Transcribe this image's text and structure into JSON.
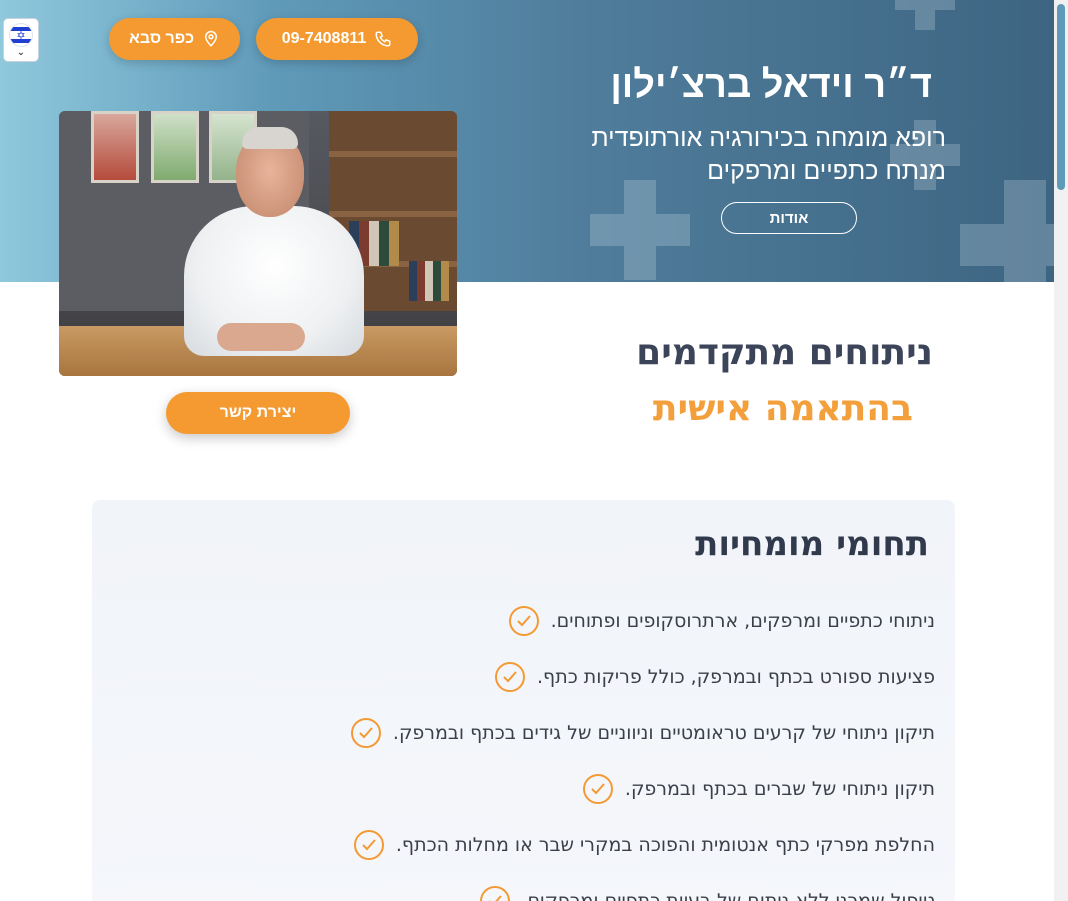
{
  "header": {
    "phone": "09-7408811",
    "location": "כפר סבא",
    "language_flag": "israel-flag"
  },
  "hero": {
    "doctor_name": "ד״ר וידאל ברצ׳ילון",
    "subtitle_line1": "רופא מומחה בכירורגיה אורתופדית",
    "subtitle_line2": "מנתח כתפיים ומרפקים",
    "about_label": "אודות"
  },
  "contact_label": "יצירת קשר",
  "tagline": {
    "line1": "ניתוחים מתקדמים",
    "line2": "בהתאמה אישית"
  },
  "expertise": {
    "title": "תחומי מומחיות",
    "items": [
      "ניתוחי כתפיים ומרפקים, ארתרוסקופים ופתוחים.",
      "פציעות ספורט בכתף ובמרפק, כולל פריקות כתף.",
      "תיקון ניתוחי של קרעים טראומטיים וניווניים של גידים בכתף ובמרפק.",
      "תיקון ניתוחי של שברים בכתף ובמרפק.",
      "החלפת מפרקי כתף אנטומית והפוכה במקרי שבר או מחלות הכתף.",
      "טיפול שמרני ללא ניתוח של בעיות כתפיים ומרפקים."
    ]
  },
  "colors": {
    "accent": "#f49a30",
    "hero_dark": "#3d6582",
    "hero_light": "#8fc8dc",
    "heading": "#313a4c"
  }
}
